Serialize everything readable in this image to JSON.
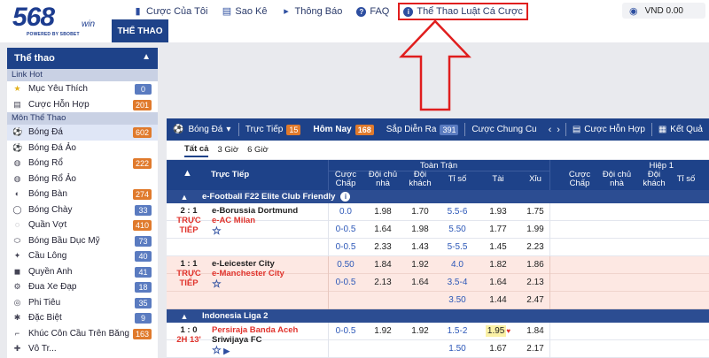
{
  "brand": {
    "logo_text": "568",
    "logo_suffix": "win",
    "powered_by": "POWERED BY SBOBET"
  },
  "topnav": [
    {
      "label": "Cược Của Tôi",
      "icon": "ticket-icon"
    },
    {
      "label": "Sao Kê",
      "icon": "statement-icon"
    },
    {
      "label": "Thông Báo",
      "icon": "megaphone-icon"
    },
    {
      "label": "FAQ",
      "icon": "question-icon"
    },
    {
      "label": "Thể Thao Luật Cá Cược",
      "icon": "info-icon",
      "highlighted": true
    }
  ],
  "balance": {
    "currency": "VND",
    "amount": "0.00",
    "icon": "eye-icon"
  },
  "section_tab": "THỂ THAO",
  "sidebar": {
    "title": "Thể thao",
    "hot_label": "Link Hot",
    "hot_items": [
      {
        "label": "Mục Yêu Thích",
        "count": "0",
        "icon": "star-icon",
        "badge_color": "#5a7bc0"
      },
      {
        "label": "Cược Hỗn Hợp",
        "count": "201",
        "icon": "parlay-icon",
        "badge_color": "#e07a2c"
      }
    ],
    "sports_label": "Môn Thể Thao",
    "sports": [
      {
        "label": "Bóng Đá",
        "count": "602",
        "icon": "soccer-ball-icon",
        "badge_color": "#e07a2c",
        "active": true
      },
      {
        "label": "Bóng Đá Ảo",
        "count": "",
        "icon": "soccer-ball-icon"
      },
      {
        "label": "Bóng Rổ",
        "count": "222",
        "icon": "basketball-icon",
        "badge_color": "#e07a2c"
      },
      {
        "label": "Bóng Rổ Ảo",
        "count": "",
        "icon": "basketball-icon"
      },
      {
        "label": "Bóng Bàn",
        "count": "274",
        "icon": "table-tennis-icon",
        "badge_color": "#e07a2c"
      },
      {
        "label": "Bóng Chày",
        "count": "33",
        "icon": "baseball-icon",
        "badge_color": "#5a7bc0"
      },
      {
        "label": "Quần Vợt",
        "count": "410",
        "icon": "tennis-icon",
        "badge_color": "#e07a2c"
      },
      {
        "label": "Bóng Bầu Dục Mỹ",
        "count": "73",
        "icon": "american-football-icon",
        "badge_color": "#5a7bc0"
      },
      {
        "label": "Cầu Lông",
        "count": "40",
        "icon": "badminton-icon",
        "badge_color": "#5a7bc0"
      },
      {
        "label": "Quyền Anh",
        "count": "41",
        "icon": "boxing-icon",
        "badge_color": "#5a7bc0"
      },
      {
        "label": "Đua Xe Đạp",
        "count": "18",
        "icon": "cycling-icon",
        "badge_color": "#5a7bc0"
      },
      {
        "label": "Phi Tiêu",
        "count": "35",
        "icon": "darts-icon",
        "badge_color": "#5a7bc0"
      },
      {
        "label": "Đặc Biệt",
        "count": "9",
        "icon": "special-icon",
        "badge_color": "#5a7bc0"
      },
      {
        "label": "Khúc Côn Cầu Trên Băng",
        "count": "163",
        "icon": "ice-hockey-icon",
        "badge_color": "#e07a2c"
      },
      {
        "label": "Vô Tr...",
        "count": "",
        "icon": "martial-arts-icon"
      }
    ]
  },
  "sportnav": {
    "sport": "Bóng Đá",
    "tabs": [
      {
        "label": "Trực Tiếp",
        "count": "15"
      },
      {
        "label": "Hôm Nay",
        "count": "168"
      },
      {
        "label": "Sắp Diễn Ra",
        "count": "391"
      },
      {
        "label": "Cược Chung Cu",
        "count": ""
      }
    ],
    "right": [
      {
        "label": "Cược Hỗn Hợp",
        "icon": "parlay-icon"
      },
      {
        "label": "Kết Quả",
        "icon": "results-icon"
      }
    ]
  },
  "filters": [
    "Tất cả",
    "3 Giờ",
    "6 Giờ"
  ],
  "table": {
    "col_live": "Trực Tiếp",
    "group_ft": "Toàn Trận",
    "group_h1": "Hiệp 1",
    "cols": [
      "Cược Chấp",
      "Đội chủ nhà",
      "Đội khách",
      "Tỉ số",
      "Tài",
      "Xỉu"
    ],
    "cols_h1": [
      "Cược Chấp",
      "Đội chủ nhà",
      "Đội khách",
      "Tỉ số"
    ]
  },
  "leagues": [
    {
      "name": "e-Football F22 Elite Club Friendly",
      "matches": [
        {
          "score": "2 : 1",
          "status": "TRỰC TIẾP",
          "home": "e-Borussia Dortmund",
          "away": "e-AC Milan",
          "style": "white",
          "home_red": false,
          "lines": [
            {
              "hdp": "0.0",
              "h": "1.98",
              "a": "1.70",
              "ou": "5.5-6",
              "o": "1.93",
              "u": "1.75"
            },
            {
              "hdp": "0-0.5",
              "h": "1.64",
              "a": "1.98",
              "ou": "5.50",
              "o": "1.77",
              "u": "1.99"
            },
            {
              "hdp": "0-0.5",
              "h": "2.33",
              "a": "1.43",
              "ou": "5-5.5",
              "o": "1.45",
              "u": "2.23"
            }
          ]
        },
        {
          "score": "1 : 1",
          "status": "TRỰC TIẾP",
          "home": "e-Leicester City",
          "away": "e-Manchester City",
          "style": "pink",
          "home_red": false,
          "lines": [
            {
              "hdp": "0.50",
              "h": "1.84",
              "a": "1.92",
              "ou": "4.0",
              "o": "1.82",
              "u": "1.86"
            },
            {
              "hdp": "0-0.5",
              "h": "2.13",
              "a": "1.64",
              "ou": "3.5-4",
              "o": "1.64",
              "u": "2.13"
            },
            {
              "hdp": "",
              "h": "",
              "a": "",
              "ou": "3.50",
              "o": "1.44",
              "u": "2.47"
            }
          ]
        }
      ]
    },
    {
      "name": "Indonesia Liga 2",
      "matches": [
        {
          "score": "1 : 0",
          "status": "2H 13'",
          "home": "Persiraja Banda Aceh",
          "away": "Sriwijaya FC",
          "style": "white",
          "home_red": true,
          "lines": [
            {
              "hdp": "0-0.5",
              "h": "1.92",
              "a": "1.92",
              "ou": "1.5-2",
              "o": "1.95",
              "u": "1.84",
              "o_hl": true
            },
            {
              "hdp": "",
              "h": "",
              "a": "",
              "ou": "1.50",
              "o": "1.67",
              "u": "2.17"
            }
          ]
        }
      ]
    }
  ],
  "annotation": {
    "color": "#e01e1e"
  }
}
